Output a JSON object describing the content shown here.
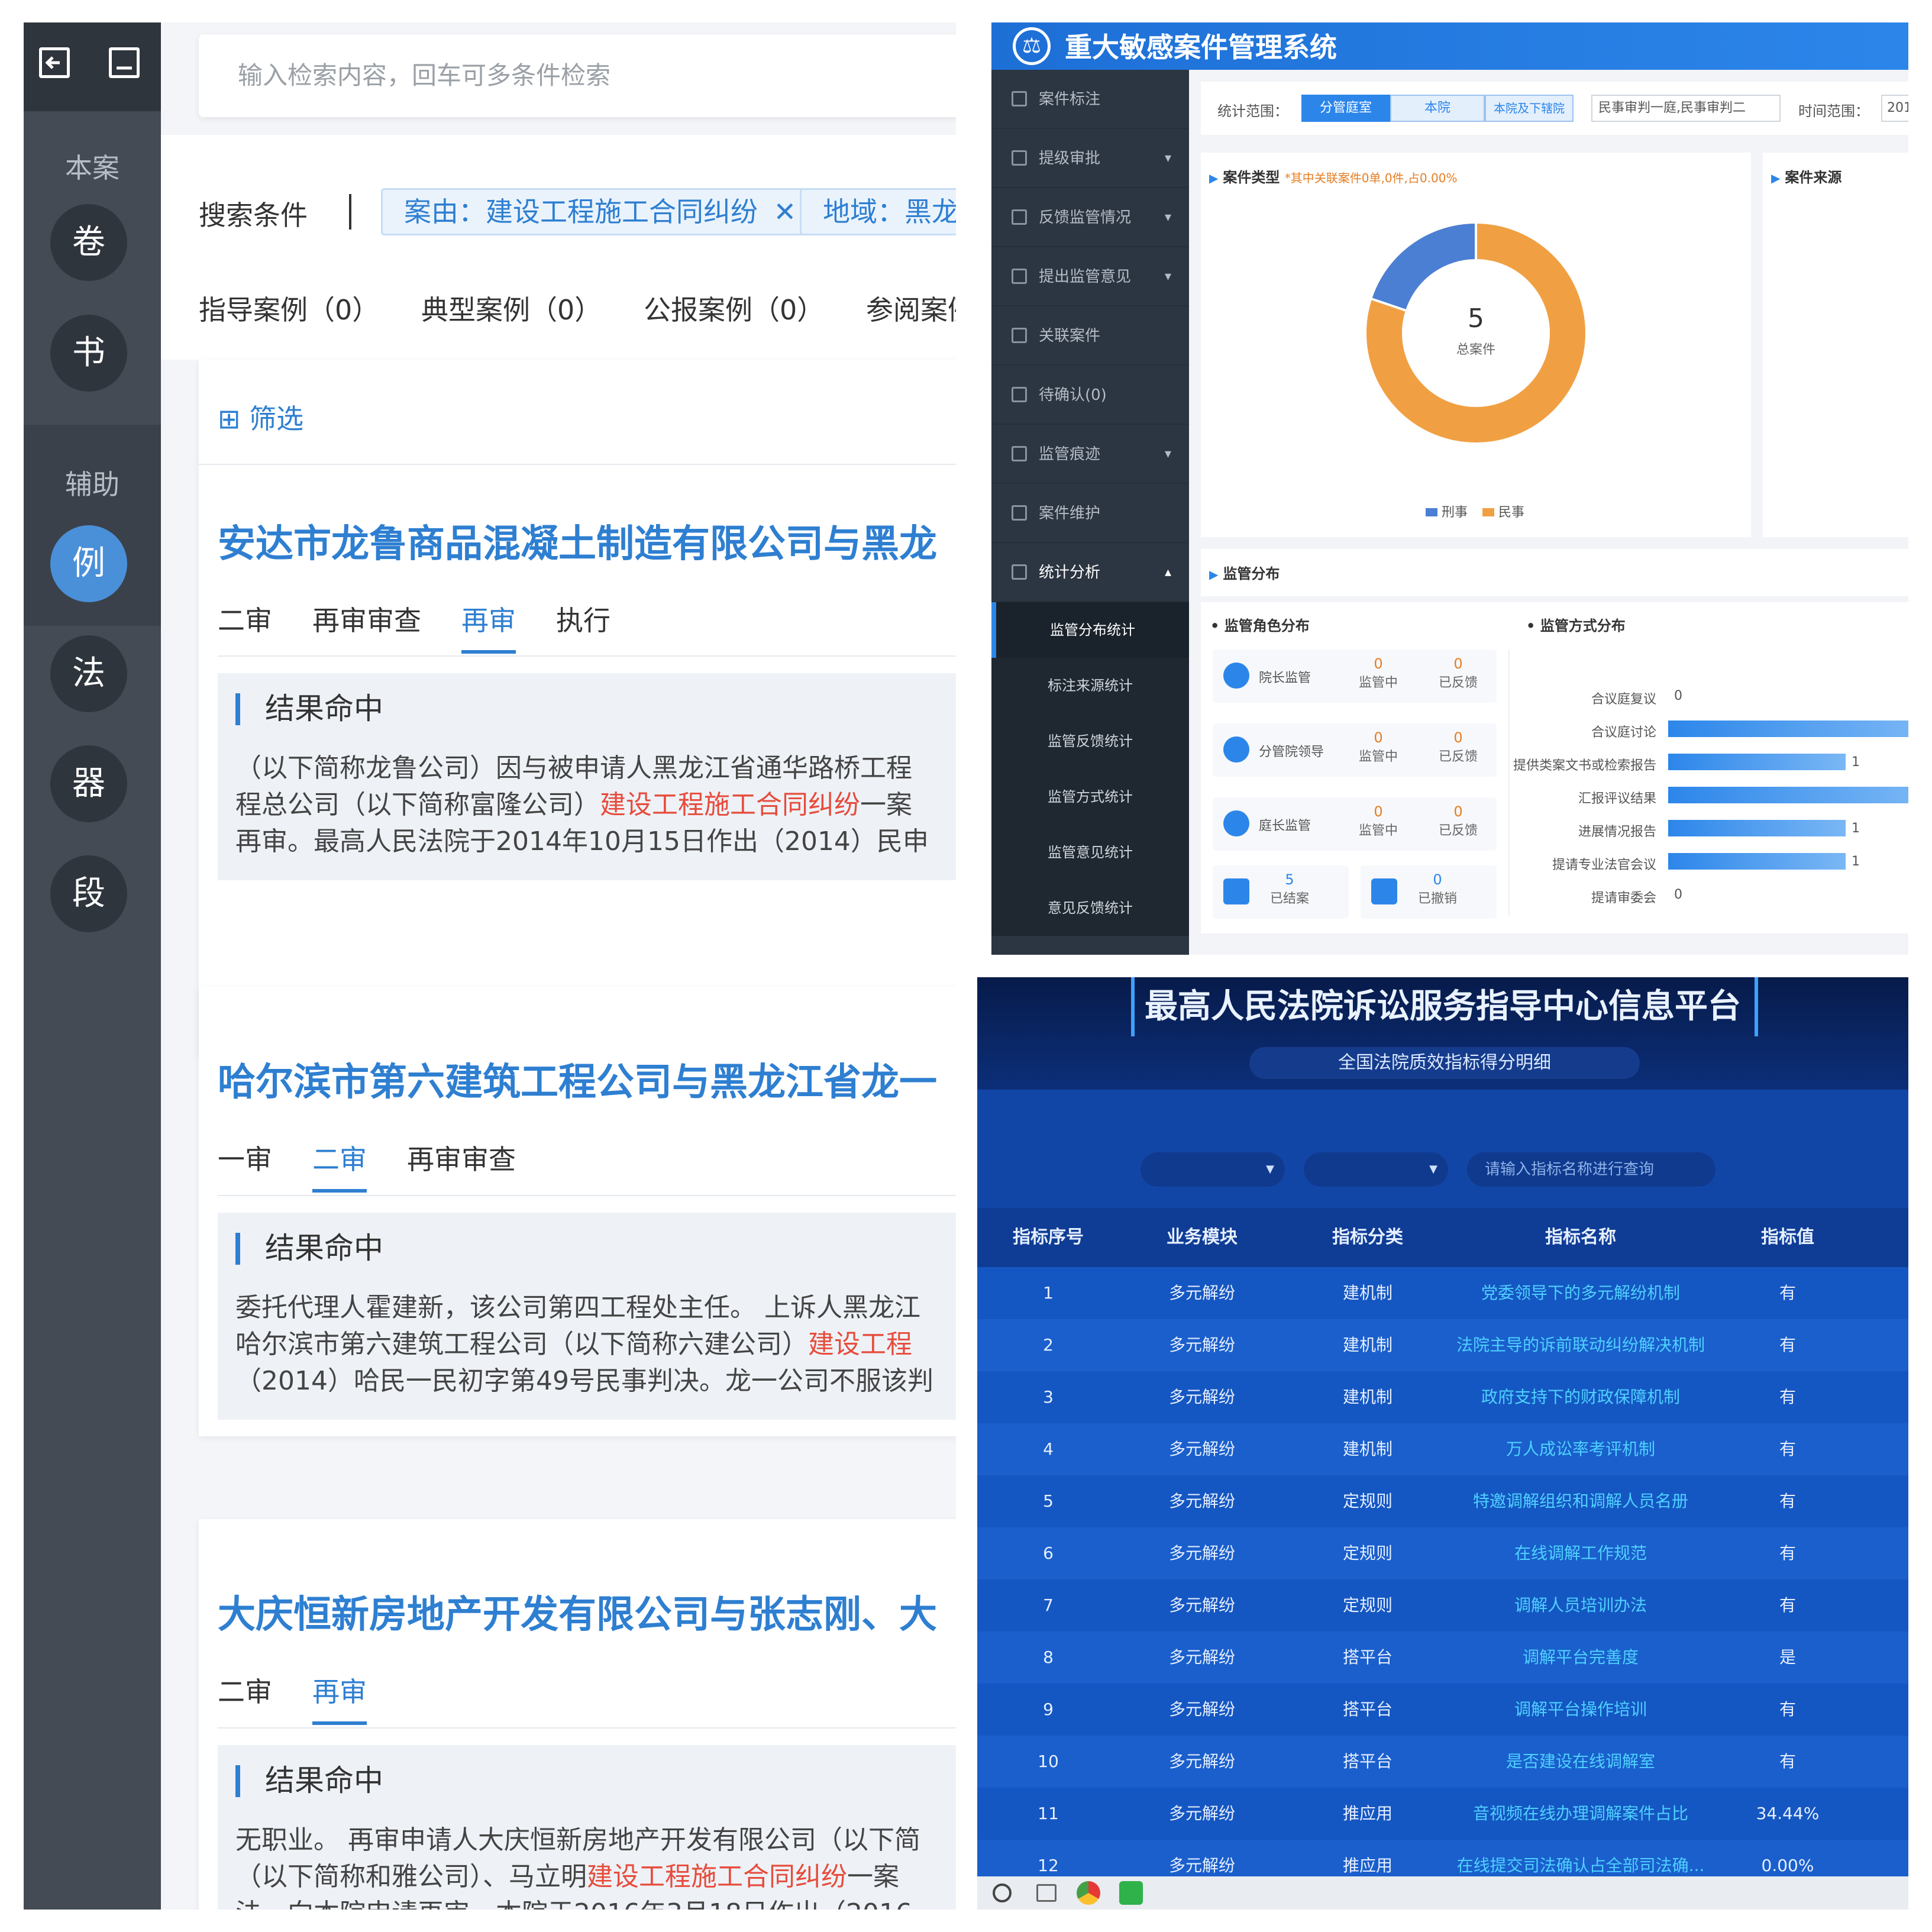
{
  "left": {
    "sidebar": {
      "section1": "本案",
      "buttons1": [
        "卷",
        "书"
      ],
      "section2": "辅助",
      "buttons2": [
        "例",
        "法",
        "器",
        "段"
      ]
    },
    "search": {
      "placeholder": "输入检索内容，回车可多条件检索"
    },
    "conditions": {
      "label": "搜索条件",
      "tags": [
        "案由：建设工程施工合同纠纷",
        "地域：黑龙"
      ]
    },
    "category_tabs": [
      "指导案例（0）",
      "典型案例（0）",
      "公报案例（0）",
      "参阅案例"
    ],
    "filter_label": "筛选",
    "cases": [
      {
        "title": "安达市龙鲁商品混凝土制造有限公司与黑龙",
        "tabs": [
          "二审",
          "再审审查",
          "再审",
          "执行"
        ],
        "active": 2,
        "hit_title": "结果命中",
        "lines": [
          {
            "pre": "（以下简称龙鲁公司）因与被申请人黑龙江省通华路桥工程",
            "red": "",
            "post": ""
          },
          {
            "pre": "程总公司（以下简称富隆公司）",
            "red": "建设工程施工合同纠纷",
            "post": "一案"
          },
          {
            "pre": "再审。最高人民法院于2014年10月15日作出（2014）民申",
            "red": "",
            "post": ""
          }
        ]
      },
      {
        "title": "哈尔滨市第六建筑工程公司与黑龙江省龙一",
        "tabs": [
          "一审",
          "二审",
          "再审审查"
        ],
        "active": 1,
        "hit_title": "结果命中",
        "lines": [
          {
            "pre": "委托代理人霍建新，该公司第四工程处主任。 上诉人黑龙江",
            "red": "",
            "post": ""
          },
          {
            "pre": "哈尔滨市第六建筑工程公司（以下简称六建公司）",
            "red": "建设工程",
            "post": ""
          },
          {
            "pre": "（2014）哈民一民初字第49号民事判决。龙一公司不服该判",
            "red": "",
            "post": ""
          }
        ]
      },
      {
        "title": "大庆恒新房地产开发有限公司与张志刚、大",
        "tabs": [
          "二审",
          "再审"
        ],
        "active": 1,
        "hit_title": "结果命中",
        "lines": [
          {
            "pre": "无职业。 再审申请人大庆恒新房地产开发有限公司（以下简",
            "red": "",
            "post": ""
          },
          {
            "pre": "（以下简称和雅公司）、马立明",
            "red": "建设工程施工合同纠纷",
            "post": "一案"
          },
          {
            "pre": "法。向本院申请再审。本院于2016年3月18日作出（2016",
            "red": "",
            "post": ""
          }
        ]
      }
    ]
  },
  "topright": {
    "title": "重大敏感案件管理系统",
    "menu": [
      {
        "label": "案件标注",
        "arrow": ""
      },
      {
        "label": "提级审批",
        "arrow": "▾"
      },
      {
        "label": "反馈监管情况",
        "arrow": "▾"
      },
      {
        "label": "提出监管意见",
        "arrow": "▾"
      },
      {
        "label": "关联案件",
        "arrow": ""
      },
      {
        "label": "待确认(0)",
        "arrow": ""
      },
      {
        "label": "监管痕迹",
        "arrow": "▾"
      },
      {
        "label": "案件维护",
        "arrow": ""
      },
      {
        "label": "统计分析",
        "arrow": "▴"
      }
    ],
    "submenu": [
      "监管分布统计",
      "标注来源统计",
      "监管反馈统计",
      "监管方式统计",
      "监管意见统计",
      "意见反馈统计"
    ],
    "submenu_active": 0,
    "filter": {
      "range_label": "统计范围：",
      "segments": [
        "分管庭室",
        "本院",
        "本院及下辖院"
      ],
      "segment_active": 0,
      "dropdown": "民事审判一庭,民事审判二",
      "time_label": "时间范围：",
      "time_value": "201"
    },
    "case_type": {
      "title": "案件类型",
      "note": "*其中关联案件0单,0件,占0.00%",
      "center_value": "5",
      "center_label": "总案件",
      "legend": [
        "刑事",
        "民事"
      ],
      "colors": [
        "#4a7fd4",
        "#f0a043"
      ]
    },
    "case_source_title": "案件来源",
    "supervision": {
      "title": "监管分布",
      "role_title": "监管角色分布",
      "method_title": "监管方式分布",
      "roles": [
        {
          "name": "院长监管",
          "supervising": "0",
          "feedback": "0"
        },
        {
          "name": "分管院领导",
          "supervising": "0",
          "feedback": "0"
        },
        {
          "name": "庭长监管",
          "supervising": "0",
          "feedback": "0"
        }
      ],
      "supervising_label": "监管中",
      "feedback_label": "已反馈",
      "closed": {
        "value": "5",
        "label": "已结案"
      },
      "withdrawn": {
        "value": "0",
        "label": "已撤销"
      },
      "methods": [
        {
          "label": "合议庭复议",
          "value": "0"
        },
        {
          "label": "合议庭讨论",
          "value": ""
        },
        {
          "label": "提供类案文书或检索报告",
          "value": "1"
        },
        {
          "label": "汇报评议结果",
          "value": ""
        },
        {
          "label": "进展情况报告",
          "value": "1"
        },
        {
          "label": "提请专业法官会议",
          "value": "1"
        },
        {
          "label": "提请审委会",
          "value": "0"
        }
      ]
    }
  },
  "bottomright": {
    "title": "最高人民法院诉讼服务指导中心信息平台",
    "subtitle": "全国法院质效指标得分明细",
    "search_placeholder": "请输入指标名称进行查询",
    "headers": [
      "指标序号",
      "业务模块",
      "指标分类",
      "指标名称",
      "指标值"
    ],
    "rows": [
      [
        "1",
        "多元解纷",
        "建机制",
        "党委领导下的多元解纷机制",
        "有"
      ],
      [
        "2",
        "多元解纷",
        "建机制",
        "法院主导的诉前联动纠纷解决机制",
        "有"
      ],
      [
        "3",
        "多元解纷",
        "建机制",
        "政府支持下的财政保障机制",
        "有"
      ],
      [
        "4",
        "多元解纷",
        "建机制",
        "万人成讼率考评机制",
        "有"
      ],
      [
        "5",
        "多元解纷",
        "定规则",
        "特邀调解组织和调解人员名册",
        "有"
      ],
      [
        "6",
        "多元解纷",
        "定规则",
        "在线调解工作规范",
        "有"
      ],
      [
        "7",
        "多元解纷",
        "定规则",
        "调解人员培训办法",
        "有"
      ],
      [
        "8",
        "多元解纷",
        "搭平台",
        "调解平台完善度",
        "是"
      ],
      [
        "9",
        "多元解纷",
        "搭平台",
        "调解平台操作培训",
        "有"
      ],
      [
        "10",
        "多元解纷",
        "搭平台",
        "是否建设在线调解室",
        "有"
      ],
      [
        "11",
        "多元解纷",
        "推应用",
        "音视频在线办理调解案件占比",
        "34.44%"
      ],
      [
        "12",
        "多元解纷",
        "推应用",
        "在线提交司法确认占全部司法确...",
        "0.00%"
      ]
    ]
  }
}
